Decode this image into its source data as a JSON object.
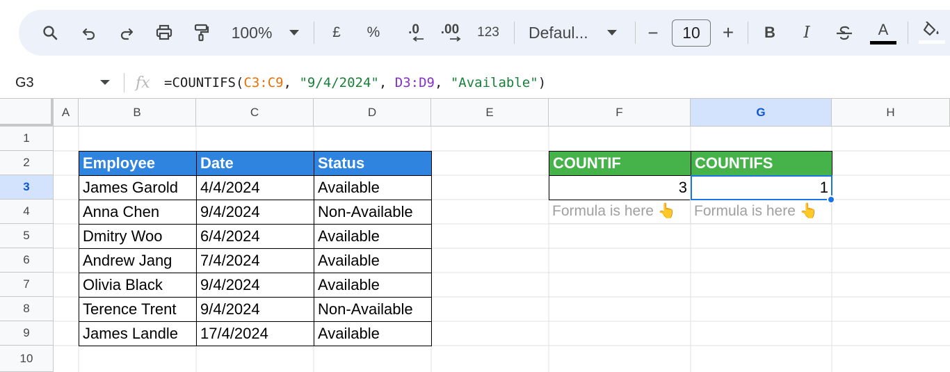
{
  "toolbar": {
    "zoom": "100%",
    "currency": "£",
    "percent": "%",
    "decrease_decimal": ".0",
    "increase_decimal": ".00",
    "number_format": "123",
    "font_name": "Defaul...",
    "font_minus": "−",
    "font_size": "10",
    "font_plus": "+",
    "bold": "B",
    "italic": "I",
    "text_color": "A",
    "text_color_swatch": "#000000",
    "fill_color_swatch": "#ffffff"
  },
  "formula_bar": {
    "name_box": "G3",
    "fx": "fx",
    "formula_parts": [
      "=COUNTIFS(",
      "C3:C9",
      ", ",
      "\"9/4/2024\"",
      ", ",
      "D3:D9",
      ", ",
      "\"Available\"",
      ")"
    ]
  },
  "columns": [
    "A",
    "B",
    "C",
    "D",
    "E",
    "F",
    "G",
    "H"
  ],
  "selected_column": "G",
  "rows": [
    "1",
    "2",
    "3",
    "4",
    "5",
    "6",
    "7",
    "8",
    "9",
    "10"
  ],
  "selected_row": "3",
  "table": {
    "headers": [
      "Employee",
      "Date",
      "Status"
    ],
    "rows": [
      [
        "James Garold",
        "4/4/2024",
        "Available"
      ],
      [
        "Anna Chen",
        "9/4/2024",
        "Non-Available"
      ],
      [
        "Dmitry Woo",
        "6/4/2024",
        "Available"
      ],
      [
        "Andrew Jang",
        "7/4/2024",
        "Available"
      ],
      [
        "Olivia Black",
        "9/4/2024",
        "Available"
      ],
      [
        "Terence Trent",
        "9/4/2024",
        "Non-Available"
      ],
      [
        "James Landle",
        "17/4/2024",
        "Available"
      ]
    ],
    "header_color": "#2f84e0"
  },
  "results": {
    "countif_label": "COUNTIF",
    "countifs_label": "COUNTIFS",
    "countif_value": "3",
    "countifs_value": "1",
    "countif_note": "Formula is here 👆",
    "countifs_note": "Formula is here 👆",
    "header_color": "#45b24a"
  },
  "selection": {
    "cell": "G3",
    "color": "#1a73e8"
  }
}
